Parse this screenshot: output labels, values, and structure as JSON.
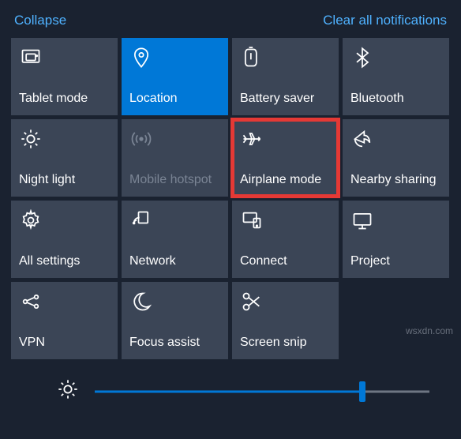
{
  "header": {
    "collapse": "Collapse",
    "clear": "Clear all notifications"
  },
  "tiles": [
    {
      "id": "tablet-mode",
      "label": "Tablet mode",
      "icon": "tablet-icon",
      "state": "default"
    },
    {
      "id": "location",
      "label": "Location",
      "icon": "location-icon",
      "state": "active"
    },
    {
      "id": "battery-saver",
      "label": "Battery saver",
      "icon": "battery-icon",
      "state": "default"
    },
    {
      "id": "bluetooth",
      "label": "Bluetooth",
      "icon": "bluetooth-icon",
      "state": "default"
    },
    {
      "id": "night-light",
      "label": "Night light",
      "icon": "sun-icon",
      "state": "default"
    },
    {
      "id": "mobile-hotspot",
      "label": "Mobile hotspot",
      "icon": "hotspot-icon",
      "state": "disabled"
    },
    {
      "id": "airplane-mode",
      "label": "Airplane mode",
      "icon": "airplane-icon",
      "state": "highlight"
    },
    {
      "id": "nearby-sharing",
      "label": "Nearby sharing",
      "icon": "share-icon",
      "state": "default"
    },
    {
      "id": "all-settings",
      "label": "All settings",
      "icon": "settings-icon",
      "state": "default"
    },
    {
      "id": "network",
      "label": "Network",
      "icon": "network-icon",
      "state": "default"
    },
    {
      "id": "connect",
      "label": "Connect",
      "icon": "connect-icon",
      "state": "default"
    },
    {
      "id": "project",
      "label": "Project",
      "icon": "project-icon",
      "state": "default"
    },
    {
      "id": "vpn",
      "label": "VPN",
      "icon": "vpn-icon",
      "state": "default"
    },
    {
      "id": "focus-assist",
      "label": "Focus assist",
      "icon": "moon-icon",
      "state": "default"
    },
    {
      "id": "screen-snip",
      "label": "Screen snip",
      "icon": "snip-icon",
      "state": "default"
    }
  ],
  "brightness": {
    "value": 80,
    "max": 100
  },
  "watermark": "wsxdn.com"
}
